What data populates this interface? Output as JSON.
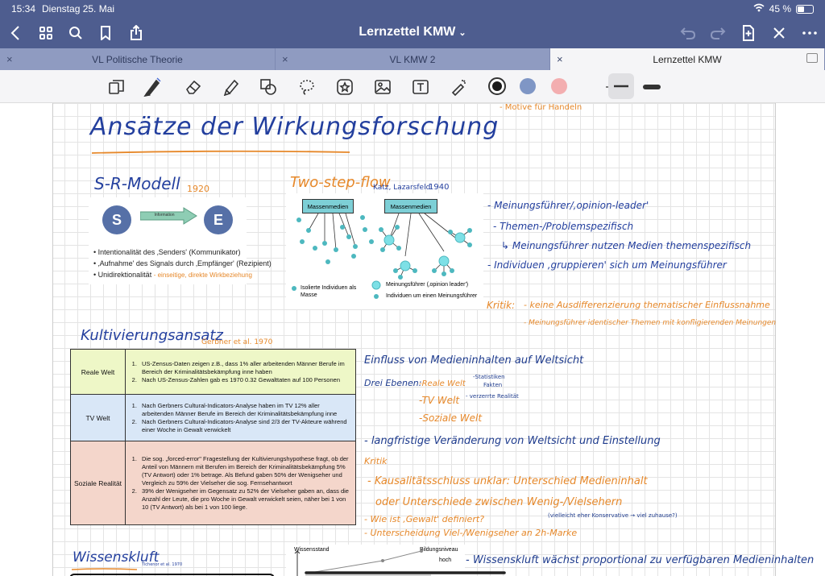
{
  "status": {
    "time": "15:34",
    "date": "Dienstag 25. Mai",
    "battery": "45 %",
    "battery_level": 0.45
  },
  "nav": {
    "title": "Lernzettel KMW"
  },
  "tabs": [
    {
      "label": "VL Politische Theorie"
    },
    {
      "label": "VL KMW 2"
    },
    {
      "label": "Lernzettel KMW"
    }
  ],
  "toolbar": {
    "colors": [
      "#1a1a1a",
      "#7f96c5",
      "#f3aeb0"
    ]
  },
  "note": {
    "top_line": "- Motive für Handeln",
    "main_title": "Ansätze der Wirkungsforschung",
    "sr": {
      "heading": "S-R-Modell",
      "year": "1920",
      "s": "S",
      "e": "E",
      "arrow_label": "Information",
      "bullets": [
        "Intentionalität des ‚Senders' (Kommunikator)",
        "‚Aufnahme' des Signals durch ‚Empfänger' (Rezipient)",
        "Unidirektionalität"
      ],
      "bullet3_note": "- einseitige, direkte Wirkbeziehung"
    },
    "twostep": {
      "heading": "Two-step-flow",
      "authors": "Katz, Lazarsfeld",
      "year": "1940",
      "box1": "Massenmedien",
      "box2": "Massenmedien",
      "legend_isolated": "Isolierte Individuen als Masse",
      "legend_leader": "Meinungsführer (‚opinion leader')",
      "legend_group": "Individuen um einen Meinungsführer"
    },
    "right_notes": [
      "- Meinungsführer/‚opinion-leader'",
      "- Themen-/Problemspezifisch",
      "↳ Meinungsführer nutzen Medien themenspezifisch",
      "- Individuen ‚gruppieren' sich um Meinungsführer"
    ],
    "kritik1": {
      "label": "Kritik:",
      "items": [
        "- keine Ausdifferenzierung thematischer Einflussnahme",
        "- Meinungsführer identischer Themen mit konfligierenden Meinungen"
      ]
    },
    "kult": {
      "heading": "Kultivierungsansatz",
      "authors": "Gerbner et al. 1970",
      "rows": [
        {
          "label": "Reale Welt",
          "items": [
            "US-Zensus-Daten zeigen z.B., dass 1% aller arbeitenden Männer Berufe im Bereich der Kriminalitätsbekämpfung inne haben",
            "Nach US-Zensus-Zahlen gab es 1970 0.32 Gewalttaten auf 100 Personen"
          ]
        },
        {
          "label": "TV Welt",
          "items": [
            "Nach Gerbners Cultural-Indicators-Analyse haben im TV 12% aller arbeitenden Männer Berufe im Bereich der Kriminalitätsbekämpfung inne",
            "Nach Gerbners Cultural-Indicators-Analyse sind 2/3 der TV-Akteure während einer Woche in Gewalt verwickelt"
          ]
        },
        {
          "label": "Soziale Realität",
          "items": [
            "Die sog. „forced-error\" Fragestellung der Kultivierungshypothese fragt, ob der Anteil von Männern mit Berufen im Bereich der Kriminalitätsbekämpfung 5% (TV Antwort) oder 1% betrage. Als Befund gaben 50% der Wenigseher und Vergleich zu 59% der Vielseher die sog. Fernsehantwort",
            "39% der Wenigseher im Gegensatz zu 52% der Vielseher gaben an, dass die Anzahl der Leute, die pro Woche in Gewalt verwickelt seien, näher bei 1 von 10 (TV Antwort) als bei 1 von 100 liege."
          ]
        }
      ]
    },
    "einfluss": {
      "title": "Einfluss von Medieninhalten auf Weltsicht",
      "ebenen": "Drei Ebenen:",
      "reale": "-Reale Welt",
      "reale_note1": "-Statistiken",
      "reale_note2": "Fakten",
      "tv": "-TV Welt",
      "tv_note": "- verzerrte Realität",
      "sozial": "-Soziale Welt",
      "langfristig": "- langfristige Veränderung von Weltsicht und Einstellung",
      "kritik": "Kritik",
      "k1": "- Kausalitätsschluss unklar: Unterschied Medieninhalt",
      "k2": "oder Unterschiede zwischen Wenig-/Vielsehern",
      "k3": "- Wie ist ‚Gewalt' definiert?",
      "k3_note": "(vielleicht eher Konservative → viel zuhause?)",
      "k4": "- Unterscheidung Viel-/Wenigseher an 2h-Marke"
    },
    "wissen": {
      "heading": "Wissenskluft",
      "authors": "Tichenor et al. 1970",
      "axis_y": "Wissensstand",
      "axis_level": "Bildungsniveau",
      "hoch": "hoch",
      "note": "- Wissenskluft wächst proportional zu verfügbaren Medieninhalten"
    }
  }
}
